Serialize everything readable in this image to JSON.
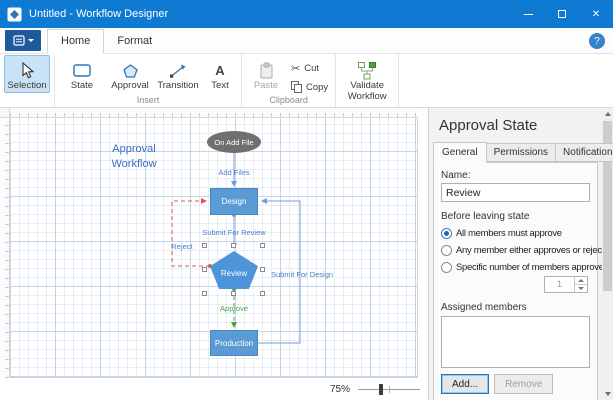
{
  "window": {
    "title": "Untitled - Workflow Designer"
  },
  "icons": {
    "close": "✕",
    "help": "?",
    "cut": "✂"
  },
  "colors": {
    "titlebar": "#0f7ad1",
    "node_blue": "#5b9bd5",
    "node_gray": "#6f6f6f",
    "connector_blue": "#6f9fd8",
    "reject_red": "#e2574c",
    "approve_green": "#43a047",
    "label_blue": "#4a7cc9",
    "ribbon_selected": "#c9e2f5"
  },
  "ribbon": {
    "tabs": [
      "Home",
      "Format"
    ],
    "buttons": {
      "selection": "Selection",
      "state": "State",
      "approval": "Approval",
      "transition": "Transition",
      "text": "Text",
      "paste": "Paste",
      "cut": "Cut",
      "copy": "Copy",
      "validate": "Validate Workflow"
    },
    "groups": {
      "insert": "Insert",
      "clipboard": "Clipboard"
    }
  },
  "canvas": {
    "title": "Approval Workflow",
    "zoom": "75%",
    "nodes": {
      "start": "On Add File",
      "design": "Design",
      "review": "Review",
      "production": "Production"
    },
    "transitions": {
      "add_files": "Add Files",
      "submit_for_review": "Submit For Review",
      "reject": "Reject",
      "approve": "Approve",
      "submit_for_design": "Submit For Design"
    }
  },
  "panel": {
    "title": "Approval State",
    "tabs": [
      "General",
      "Permissions",
      "Notifications"
    ],
    "general": {
      "name_label": "Name:",
      "name_value": "Review",
      "leaving_label": "Before leaving state",
      "options": [
        {
          "label": "All members must approve",
          "selected": true
        },
        {
          "label": "Any member either approves or rejects",
          "selected": false
        },
        {
          "label": "Specific number of members approves",
          "selected": false
        }
      ],
      "spinner_value": "1",
      "members_label": "Assigned members",
      "add_label": "Add...",
      "remove_label": "Remove"
    }
  }
}
